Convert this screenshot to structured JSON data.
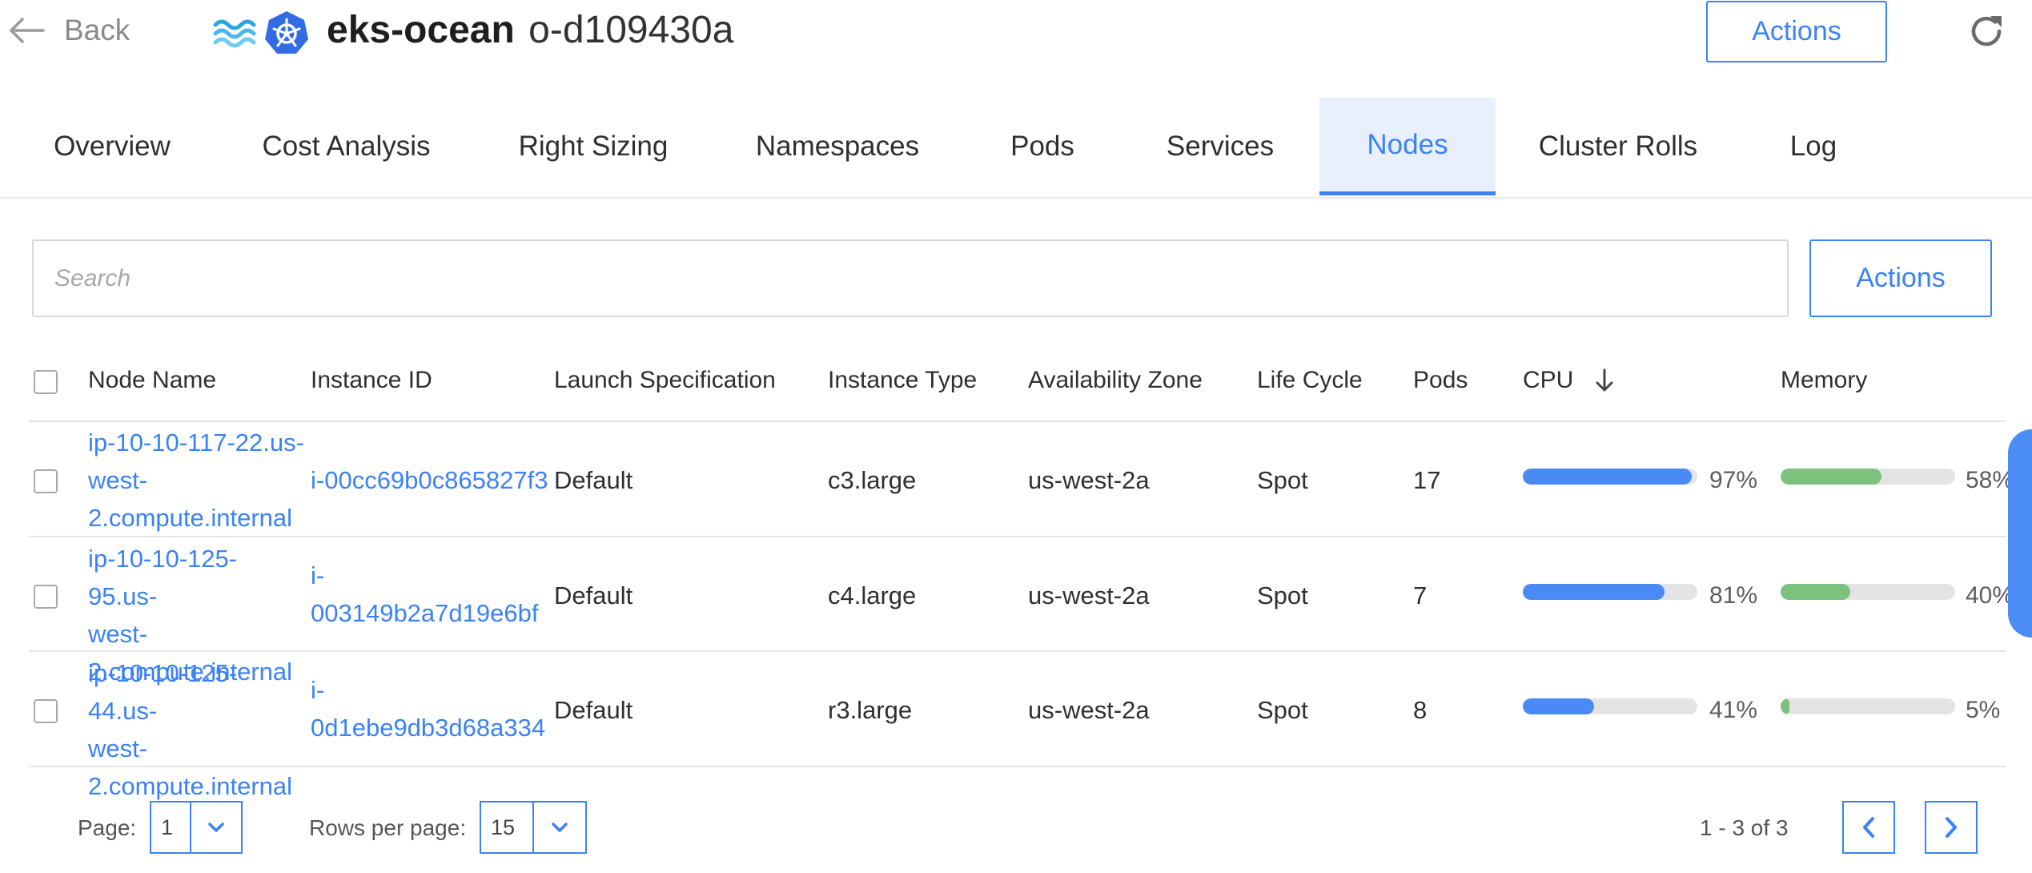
{
  "header": {
    "back_label": "Back",
    "cluster_name": "eks-ocean",
    "cluster_id": "o-d109430a",
    "actions_label": "Actions",
    "icons": [
      "back-arrow-icon",
      "spot-ocean-logo-icon",
      "kubernetes-logo-icon",
      "refresh-icon"
    ]
  },
  "tabs": [
    {
      "label": "Overview"
    },
    {
      "label": "Cost Analysis"
    },
    {
      "label": "Right Sizing"
    },
    {
      "label": "Namespaces"
    },
    {
      "label": "Pods"
    },
    {
      "label": "Services"
    },
    {
      "label": "Nodes",
      "active": true
    },
    {
      "label": "Cluster Rolls"
    },
    {
      "label": "Log"
    }
  ],
  "search": {
    "placeholder": "Search"
  },
  "table_actions_label": "Actions",
  "table": {
    "columns": [
      "Node Name",
      "Instance ID",
      "Launch Specification",
      "Instance Type",
      "Availability Zone",
      "Life Cycle",
      "Pods",
      "CPU",
      "Memory"
    ],
    "sort": {
      "column": "CPU",
      "direction": "desc"
    },
    "rows": [
      {
        "node_name": [
          "ip-10-10-117-22.us-",
          "west-",
          "2.compute.internal"
        ],
        "instance_id": [
          "i-00cc69b0c865827f3"
        ],
        "launch_spec": "Default",
        "instance_type": "c3.large",
        "az": "us-west-2a",
        "life_cycle": "Spot",
        "pods": "17",
        "cpu": "97%",
        "cpu_value": 97,
        "memory": "58%",
        "memory_value": 58
      },
      {
        "node_name": [
          "ip-10-10-125-95.us-",
          "west-",
          "2.compute.internal"
        ],
        "instance_id": [
          "i-",
          "003149b2a7d19e6bf"
        ],
        "launch_spec": "Default",
        "instance_type": "c4.large",
        "az": "us-west-2a",
        "life_cycle": "Spot",
        "pods": "7",
        "cpu": "81%",
        "cpu_value": 81,
        "memory": "40%",
        "memory_value": 40
      },
      {
        "node_name": [
          "ip-10-10-125-44.us-",
          "west-",
          "2.compute.internal"
        ],
        "instance_id": [
          "i-",
          "0d1ebe9db3d68a334"
        ],
        "launch_spec": "Default",
        "instance_type": "r3.large",
        "az": "us-west-2a",
        "life_cycle": "Spot",
        "pods": "8",
        "cpu": "41%",
        "cpu_value": 41,
        "memory": "5%",
        "memory_value": 5
      }
    ]
  },
  "footer": {
    "page_label": "Page:",
    "page_value": "1",
    "rows_label": "Rows per page:",
    "rows_value": "15",
    "range_text": "1 - 3 of 3"
  },
  "colors": {
    "accent": "#3b82f6",
    "cpu_bar": "#4a8af4",
    "memory_bar": "#7cc17e",
    "bar_track": "#e4e4e6",
    "active_tab_bg": "#e9f0fd"
  }
}
